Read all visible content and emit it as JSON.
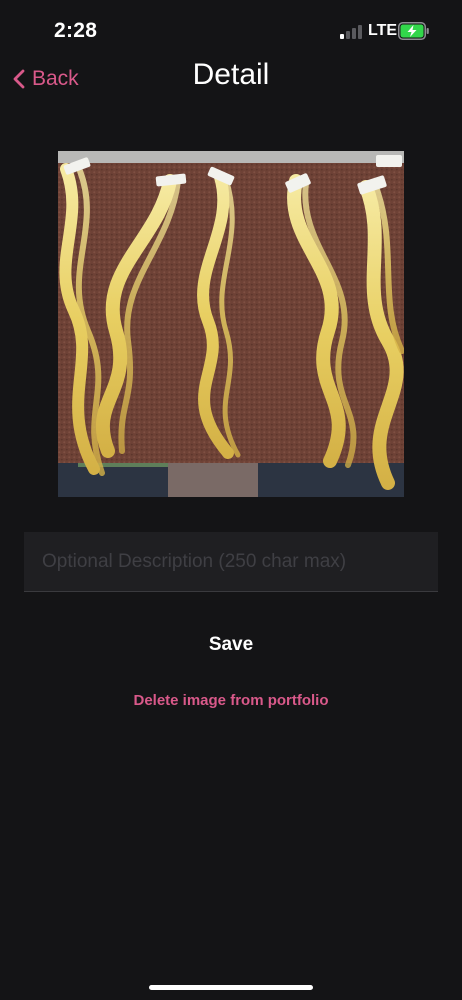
{
  "status_bar": {
    "time": "2:28",
    "network": "LTE",
    "signal_bars_active": 1,
    "signal_bars_total": 4,
    "battery_state": "charging",
    "battery_color": "#32d74b"
  },
  "nav": {
    "back_label": "Back",
    "title": "Detail",
    "accent_color": "#d9598a"
  },
  "photo": {
    "icon": "photo-of-blonde-wavy-hair-extensions-on-brown-towel"
  },
  "description": {
    "value": "",
    "placeholder": "Optional Description (250 char max)"
  },
  "actions": {
    "save_label": "Save",
    "delete_label": "Delete image from portfolio",
    "delete_color": "#d9598a"
  }
}
